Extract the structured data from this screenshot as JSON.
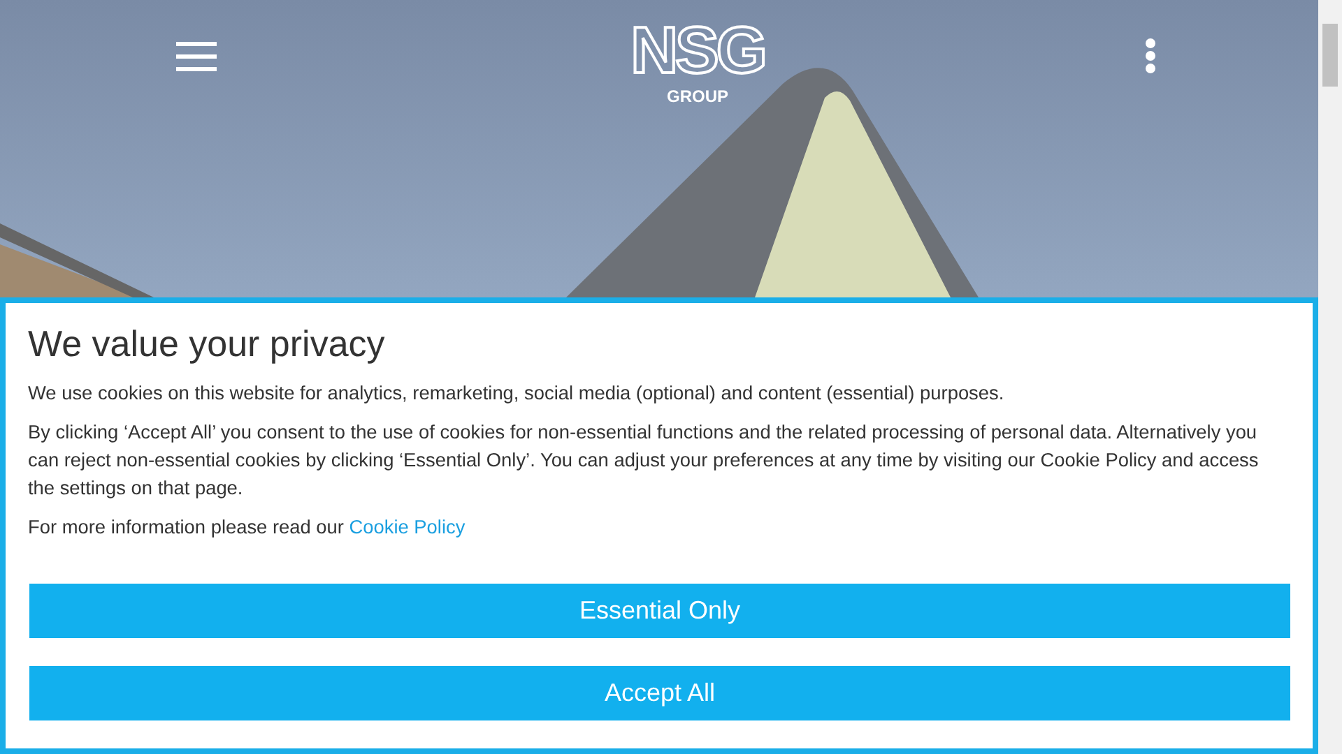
{
  "header": {
    "logo": "NSG",
    "logo_subtitle": "GROUP"
  },
  "cookie_banner": {
    "title": "We value your privacy",
    "paragraphs": [
      "We use cookies on this website for analytics, remarketing, social media (optional) and content (essential) purposes.",
      "By clicking ‘Accept All’ you consent to the use of cookies for non-essential functions and the related processing of personal data. Alternatively you can reject non-essential cookies by clicking ‘Essential Only’. You can adjust your preferences at any time by visiting our Cookie Policy and access the settings on that page."
    ],
    "more_info": "For more information please read our",
    "link": "Cookie Policy",
    "buttons": [
      "Essential Only",
      "Accept All"
    ]
  }
}
